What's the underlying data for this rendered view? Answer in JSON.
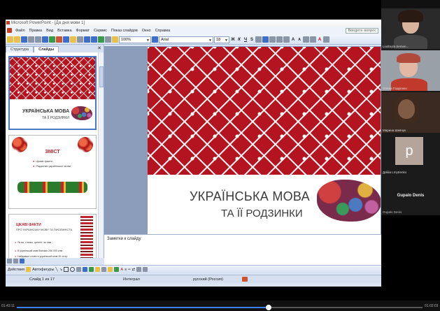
{
  "window": {
    "title": "Microsoft PowerPoint - [Да дня мови 1]",
    "menu": [
      "Файл",
      "Правка",
      "Вид",
      "Вставка",
      "Формат",
      "Сервис",
      "Показ слайдов",
      "Окно",
      "Справка"
    ],
    "help_box": "Введите вопрос",
    "zoom": "100%",
    "font_name": "Arial",
    "font_size": "18"
  },
  "panel": {
    "tabs": [
      "Структура",
      "Слайды"
    ],
    "active_tab": "Слайды",
    "close_label": "✕"
  },
  "thumbnails": {
    "slide1": {
      "title": "УКРАЇНСЬКА МОВА",
      "subtitle": "ТА ЇЇ РОДЗИНКИ"
    },
    "slide2": {
      "title": "ЗМІСТ",
      "lines": [
        "Цікаві факти",
        "Родзинки української мови"
      ]
    },
    "slide3": {
      "title": "ЦІКАВІ ФАКТИ",
      "subtitle": "ПРО УКРАЇНСЬКУ МОВУ ТА ПИСЕМНІСТЬ",
      "lines": [
        "Як ви, о мово, цвітете, як нам...",
        "В українській мові близько 256 000 слів",
        "Найдовше слово в українській мові 30 літер"
      ]
    }
  },
  "main_slide": {
    "title": "УКРАЇНСЬКА МОВА",
    "subtitle": "ТА ЇЇ РОДЗИНКИ"
  },
  "notes": {
    "placeholder": "Заметки к слайду"
  },
  "drawbar": {
    "actions": "Действия",
    "autoshapes": "Автофигуры"
  },
  "status": {
    "slide_counter": "Слайд 1 из 17",
    "design": "Интеграл",
    "language": "русский (Россия)"
  },
  "participants": [
    {
      "name": "Liudmyla Semen..."
    },
    {
      "name": "Олена Гордієнко"
    },
    {
      "name": "Марина Шевчук"
    },
    {
      "name": "Дoliiia Lmytrenko",
      "initial": "p"
    }
  ],
  "speaker": {
    "big_name": "Gupalo Denis",
    "name": "Gupalo Denis"
  },
  "player": {
    "current_time": "01:43:11",
    "end_time": "01:02:03",
    "progress": 0.62
  },
  "colors": {
    "ornament_red": "#b3141f",
    "accent_blue": "#3b82f6"
  }
}
